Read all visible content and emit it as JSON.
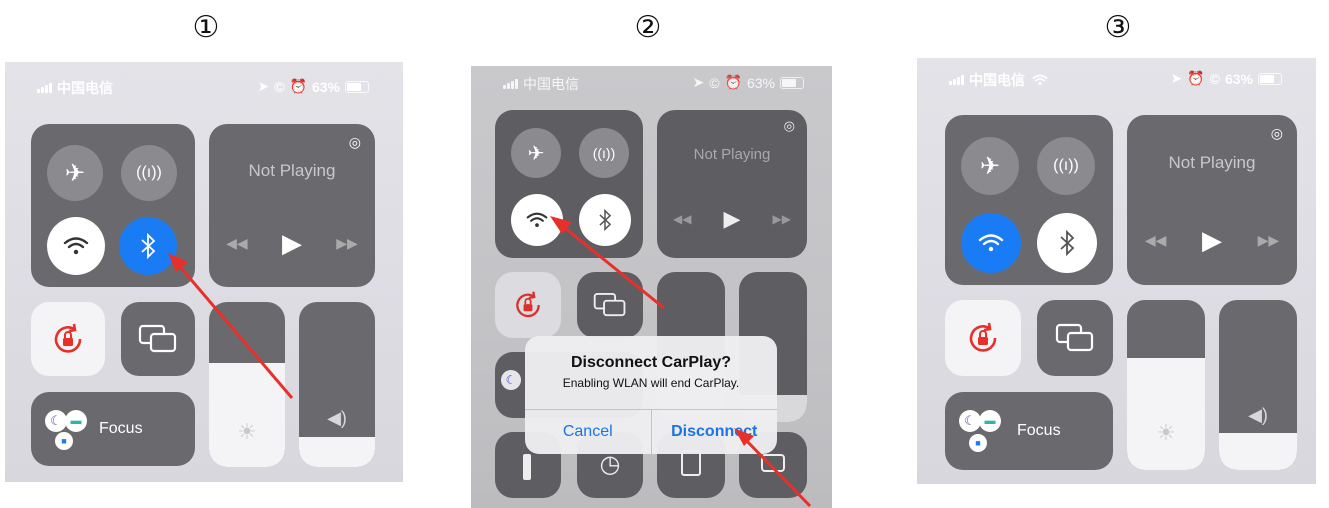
{
  "steps": [
    "①",
    "②",
    "③"
  ],
  "status": {
    "carrier": "中国电信",
    "battery": "63%"
  },
  "now_playing": {
    "title": "Not Playing"
  },
  "focus": {
    "label": "Focus"
  },
  "dialog": {
    "title": "Disconnect CarPlay?",
    "message": "Enabling WLAN will end CarPlay.",
    "cancel": "Cancel",
    "disconnect": "Disconnect"
  },
  "icons": {
    "airplane": "airplane-icon",
    "cellular": "cellular-icon",
    "wifi": "wifi-icon",
    "bluetooth": "bluetooth-icon",
    "airplay": "airplay-icon",
    "rotation_lock": "rotation-lock-icon",
    "mirroring": "screen-mirroring-icon",
    "brightness": "brightness-icon",
    "volume": "volume-icon"
  },
  "colors": {
    "active_blue": "#1a7cf5",
    "arrow_red": "#e8302a"
  }
}
